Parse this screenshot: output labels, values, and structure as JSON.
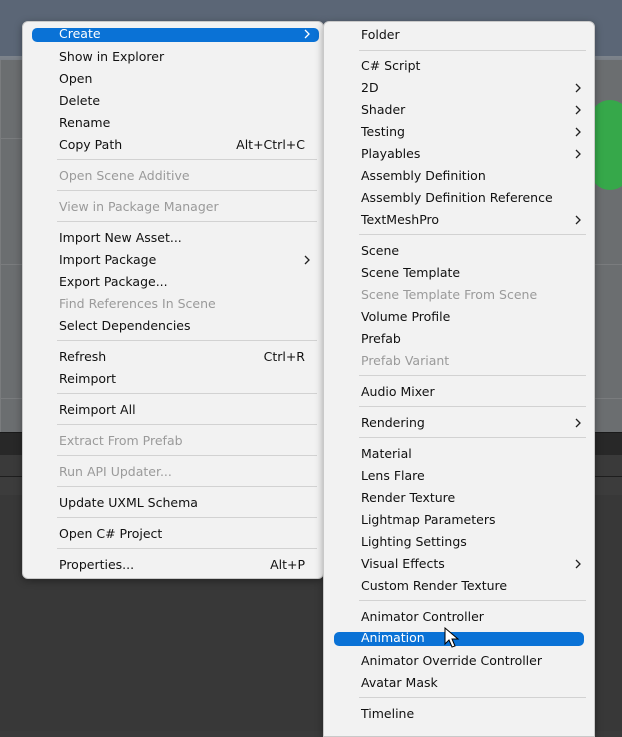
{
  "left_menu": {
    "items": [
      {
        "label": "Create",
        "submenu": true,
        "selected": true
      },
      {
        "label": "Show in Explorer"
      },
      {
        "label": "Open"
      },
      {
        "label": "Delete"
      },
      {
        "label": "Rename"
      },
      {
        "label": "Copy Path",
        "shortcut": "Alt+Ctrl+C"
      },
      {
        "label": "Open Scene Additive",
        "disabled": true
      },
      {
        "label": "View in Package Manager",
        "disabled": true
      },
      {
        "label": "Import New Asset..."
      },
      {
        "label": "Import Package",
        "submenu": true
      },
      {
        "label": "Export Package..."
      },
      {
        "label": "Find References In Scene",
        "disabled": true
      },
      {
        "label": "Select Dependencies"
      },
      {
        "label": "Refresh",
        "shortcut": "Ctrl+R"
      },
      {
        "label": "Reimport"
      },
      {
        "label": "Reimport All"
      },
      {
        "label": "Extract From Prefab",
        "disabled": true
      },
      {
        "label": "Run API Updater...",
        "disabled": true
      },
      {
        "label": "Update UXML Schema"
      },
      {
        "label": "Open C# Project"
      },
      {
        "label": "Properties...",
        "shortcut": "Alt+P"
      }
    ]
  },
  "right_menu": {
    "items": [
      {
        "label": "Folder"
      },
      {
        "label": "C# Script"
      },
      {
        "label": "2D",
        "submenu": true
      },
      {
        "label": "Shader",
        "submenu": true
      },
      {
        "label": "Testing",
        "submenu": true
      },
      {
        "label": "Playables",
        "submenu": true
      },
      {
        "label": "Assembly Definition"
      },
      {
        "label": "Assembly Definition Reference"
      },
      {
        "label": "TextMeshPro",
        "submenu": true
      },
      {
        "label": "Scene"
      },
      {
        "label": "Scene Template"
      },
      {
        "label": "Scene Template From Scene",
        "disabled": true
      },
      {
        "label": "Volume Profile"
      },
      {
        "label": "Prefab"
      },
      {
        "label": "Prefab Variant",
        "disabled": true
      },
      {
        "label": "Audio Mixer"
      },
      {
        "label": "Rendering",
        "submenu": true
      },
      {
        "label": "Material"
      },
      {
        "label": "Lens Flare"
      },
      {
        "label": "Render Texture"
      },
      {
        "label": "Lightmap Parameters"
      },
      {
        "label": "Lighting Settings"
      },
      {
        "label": "Visual Effects",
        "submenu": true
      },
      {
        "label": "Custom Render Texture"
      },
      {
        "label": "Animator Controller"
      },
      {
        "label": "Animation",
        "selected": true
      },
      {
        "label": "Animator Override Controller"
      },
      {
        "label": "Avatar Mask"
      },
      {
        "label": "Timeline"
      }
    ]
  },
  "colors": {
    "highlight": "#0a72d6",
    "menu_bg": "#f2f2f2",
    "disabled_text": "#9a9a9a"
  },
  "icons": {
    "submenu": "chevron-right-icon",
    "cursor": "mouse-pointer-icon"
  }
}
